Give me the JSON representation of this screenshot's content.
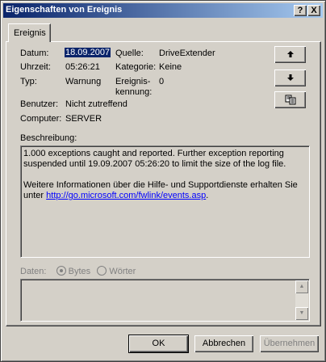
{
  "window": {
    "title": "Eigenschaften von Ereignis"
  },
  "titlebar_buttons": {
    "help": "?",
    "close": "X"
  },
  "tabs": [
    {
      "label": "Ereignis"
    }
  ],
  "fields": {
    "datum_label": "Datum:",
    "datum_value": "18.09.2007",
    "quelle_label": "Quelle:",
    "quelle_value": "DriveExtender",
    "uhrzeit_label": "Uhrzeit:",
    "uhrzeit_value": "05:26:21",
    "kategorie_label": "Kategorie:",
    "kategorie_value": "Keine",
    "typ_label": "Typ:",
    "typ_value": "Warnung",
    "kennung_label_1": "Ereignis-",
    "kennung_label_2": "kennung:",
    "kennung_value": "0",
    "benutzer_label": "Benutzer:",
    "benutzer_value": "Nicht zutreffend",
    "computer_label": "Computer:",
    "computer_value": "SERVER"
  },
  "nav_buttons": [
    {
      "name": "previous",
      "icon": "arrow-up-icon",
      "glyph": "🡅"
    },
    {
      "name": "next",
      "icon": "arrow-down-icon",
      "glyph": "🡇"
    },
    {
      "name": "copy",
      "icon": "copy-icon",
      "glyph": "⧉"
    }
  ],
  "description": {
    "label": "Beschreibung:",
    "line1": "1.000 exceptions caught and reported. Further exception reporting",
    "line2": "suspended until 19.09.2007 05:26:20 to limit the size of the log file.",
    "line3": "Weitere Informationen über die Hilfe- und Supportdienste erhalten Sie",
    "line4_prefix": "unter ",
    "link": "http://go.microsoft.com/fwlink/events.asp",
    "line4_suffix": "."
  },
  "data_section": {
    "label": "Daten:",
    "option_bytes": "Bytes",
    "option_words": "Wörter",
    "selected": "Bytes"
  },
  "buttons": {
    "ok": "OK",
    "cancel": "Abbrechen",
    "apply": "Übernehmen"
  }
}
